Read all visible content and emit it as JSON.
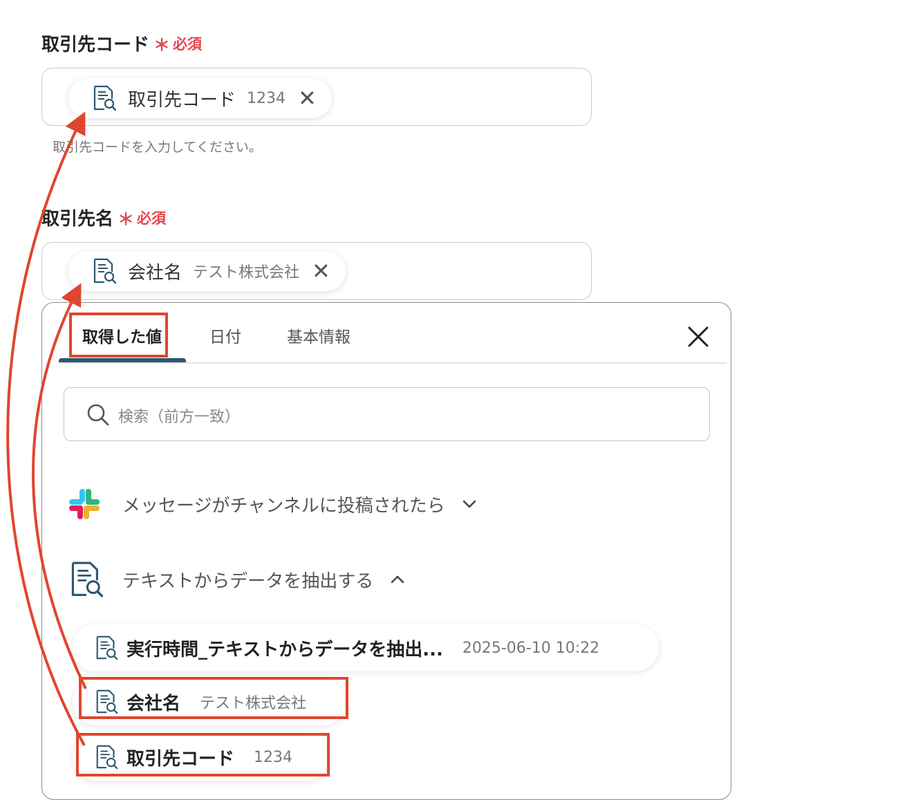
{
  "fields": [
    {
      "label": "取引先コード",
      "required_star": "＊",
      "required_text": "必須",
      "chip_name": "取引先コード",
      "chip_value": "1234",
      "helper": "取引先コードを入力してください。"
    },
    {
      "label": "取引先名",
      "required_star": "＊",
      "required_text": "必須",
      "chip_name": "会社名",
      "chip_value": "テスト株式会社"
    }
  ],
  "panel": {
    "tabs": [
      {
        "label": "取得した値",
        "active": true
      },
      {
        "label": "日付",
        "active": false
      },
      {
        "label": "基本情報",
        "active": false
      }
    ],
    "search_placeholder": "検索（前方一致）",
    "sections": [
      {
        "title": "メッセージがチャンネルに投稿されたら",
        "icon": "slack-icon",
        "expanded": false
      },
      {
        "title": "テキストからデータを抽出する",
        "icon": "document-search-icon",
        "expanded": true
      }
    ],
    "outputs": [
      {
        "name": "実行時間_テキストからデータを抽出...",
        "value": "2025-06-10 10:22"
      },
      {
        "name": "会社名",
        "value": "テスト株式会社"
      },
      {
        "name": "取引先コード",
        "value": "1234"
      }
    ]
  },
  "colors": {
    "required": "#e5454b",
    "highlight": "#e0462f",
    "tab_underline": "#2c5670",
    "icon": "#2c5670"
  }
}
